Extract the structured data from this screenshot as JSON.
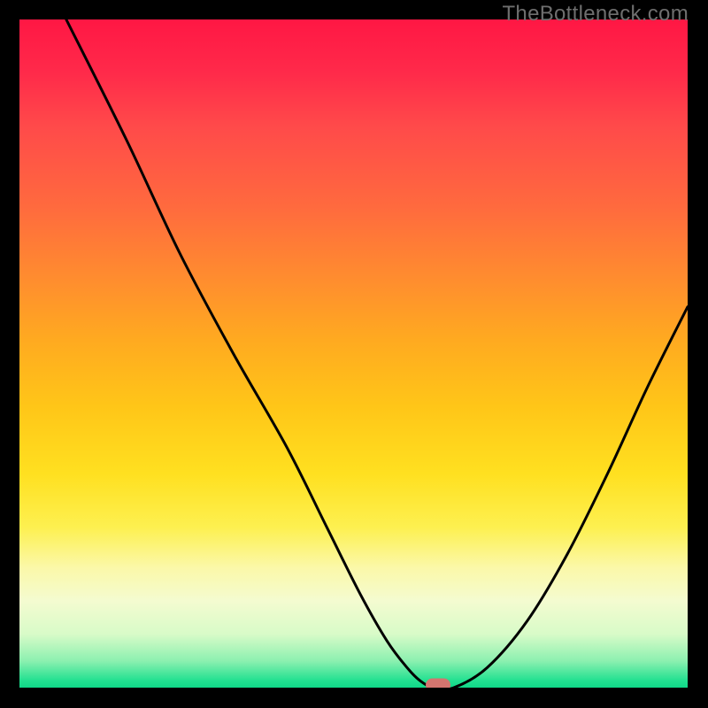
{
  "watermark": "TheBottleneck.com",
  "colors": {
    "frame": "#000000",
    "curve_stroke": "#000000",
    "marker_fill": "#d4756f",
    "bg_top": "#ff1744",
    "bg_bottom": "#10d888"
  },
  "chart_data": {
    "type": "line",
    "title": "",
    "xlabel": "",
    "ylabel": "",
    "xlim": [
      0,
      100
    ],
    "ylim": [
      0,
      100
    ],
    "x": [
      7,
      16,
      24,
      32,
      40,
      46,
      51,
      55,
      58,
      60,
      62,
      65,
      70,
      76,
      82,
      88,
      94,
      100
    ],
    "values": [
      100,
      82,
      65,
      50,
      36,
      24,
      14,
      7,
      3,
      1,
      0,
      0,
      3,
      10,
      20,
      32,
      45,
      57
    ],
    "minimum_point": {
      "x": 62.6,
      "y": 0
    },
    "marker": {
      "x": 62.6,
      "y": 0,
      "shape": "pill"
    }
  }
}
